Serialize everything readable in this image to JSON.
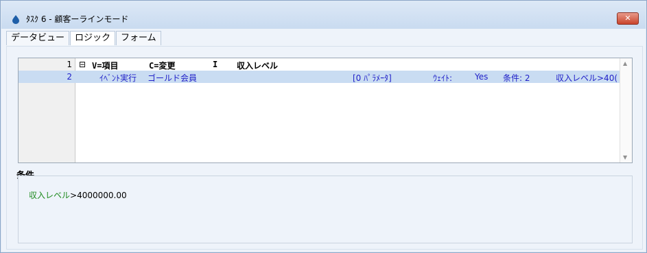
{
  "window": {
    "title": "ﾀｽｸ 6 -  顧客ーラインモード",
    "close_label": "✕"
  },
  "tabs": [
    {
      "label": "データビュー"
    },
    {
      "label": "ロジック"
    },
    {
      "label": "フォーム"
    }
  ],
  "grid": {
    "header_row": {
      "num": "1",
      "expander": "⊟",
      "col1": "V=項目",
      "col2": "C=変更",
      "col3": "I",
      "col4": "収入レベル"
    },
    "row2": {
      "num": "2",
      "event": "ｲﾍﾞﾝﾄ実行",
      "target": "ゴールド会員",
      "params": "[0 ﾊﾟﾗﾒｰﾀ]",
      "wait_label": "ｳｪｲﾄ:",
      "wait_value": "Yes",
      "cond_label": "条件: 2",
      "cond_expr": "収入レベル>40("
    },
    "scroll_up": "▲",
    "scroll_down": "▼"
  },
  "condition": {
    "label": "条件",
    "field": "収入レベル",
    "rest": ">4000000.00"
  },
  "colors": {
    "selected_row": "#c9dcf2",
    "link_blue": "#2020c8",
    "green": "#1e8a1e"
  }
}
